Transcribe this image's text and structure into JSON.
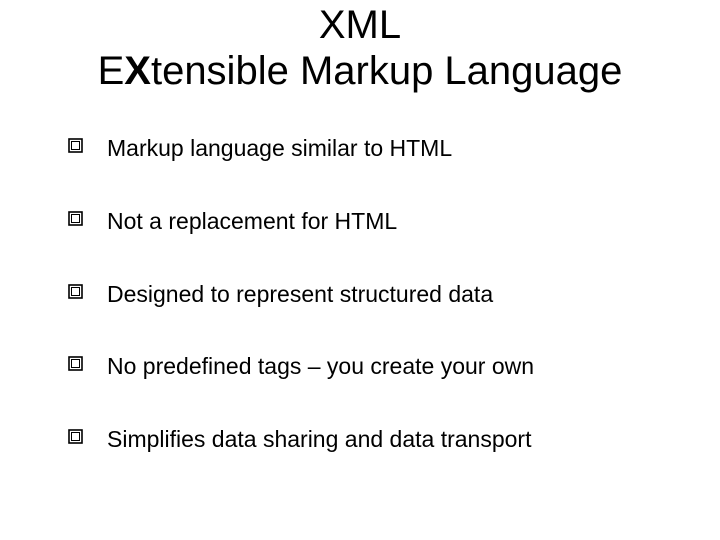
{
  "title": {
    "line1_plain": "XML",
    "line2_prefix": "E",
    "line2_bold": "X",
    "line2_rest": "tensible Markup Language"
  },
  "bullets": [
    {
      "text": "Markup language similar to HTML"
    },
    {
      "text": "Not a replacement for HTML"
    },
    {
      "text": "Designed to represent structured data"
    },
    {
      "text": "No predefined tags – you create your own"
    },
    {
      "text": "Simplifies data sharing and data transport"
    }
  ]
}
